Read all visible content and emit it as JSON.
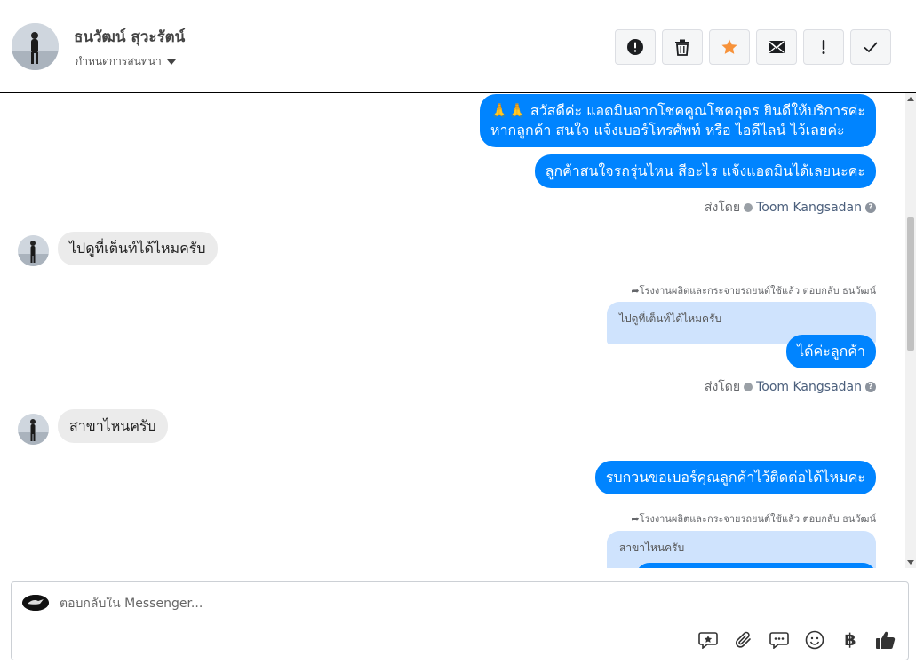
{
  "header": {
    "contact_name": "ธนวัฒน์ สุวะรัตน์",
    "conversation_settings": "กำหนดการสนทนา",
    "toolbar": [
      {
        "icon": "alert-circle-icon",
        "name": "spam-button"
      },
      {
        "icon": "trash-icon",
        "name": "delete-button"
      },
      {
        "icon": "star-icon",
        "name": "star-button"
      },
      {
        "icon": "envelope-icon",
        "name": "mark-unread-button"
      },
      {
        "icon": "exclamation-icon",
        "name": "follow-up-button"
      },
      {
        "icon": "check-icon",
        "name": "mark-done-button"
      }
    ],
    "star_color": "#f7923a"
  },
  "messages": {
    "out1_line1": "🙏🙏 สวัสดีค่ะ แอดมินจากโชคคูณโชคอุดร ยินดีให้บริการค่ะ",
    "out1_line2": "หากลูกค้า สนใจ แจ้งเบอร์โทรศัพท์ หรือ ไอดีไลน์  ไว้เลยค่ะ",
    "out2": "ลูกค้าสนใจรถรุ่นไหน สีอะไร แจ้งแอดมินได้เลยนะคะ",
    "sent_by_label": "ส่งโดย",
    "agent_name": "Toom Kangsadan",
    "in1": "ไปดูที่เต็นท์ได้ไหมครับ",
    "reply_note": "โรงงานผลิตและกระจายรถยนต์ใช้แล้ว ตอบกลับ ธนวัฒน์",
    "quote1": "ไปดูที่เต็นท์ได้ไหมครับ",
    "out3": "ได้ค่ะลูกค้า",
    "in2": "สาขาไหนครับ",
    "out4": "รบกวนขอเบอร์คุณลูกค้าไว้ติดต่อได้ไหมคะ",
    "quote2": "สาขาไหนครับ"
  },
  "composer": {
    "placeholder": "ตอบกลับใน Messenger...",
    "tools": [
      "saved-reply-icon",
      "attach-icon",
      "chat-bubble-icon",
      "emoji-icon",
      "baht-icon",
      "thumbs-up-icon"
    ],
    "baht_symbol": "฿"
  },
  "colors": {
    "outgoing_bubble": "#0084ff",
    "incoming_bubble": "#ebebeb",
    "quote_bubble": "#cfe3fd"
  }
}
